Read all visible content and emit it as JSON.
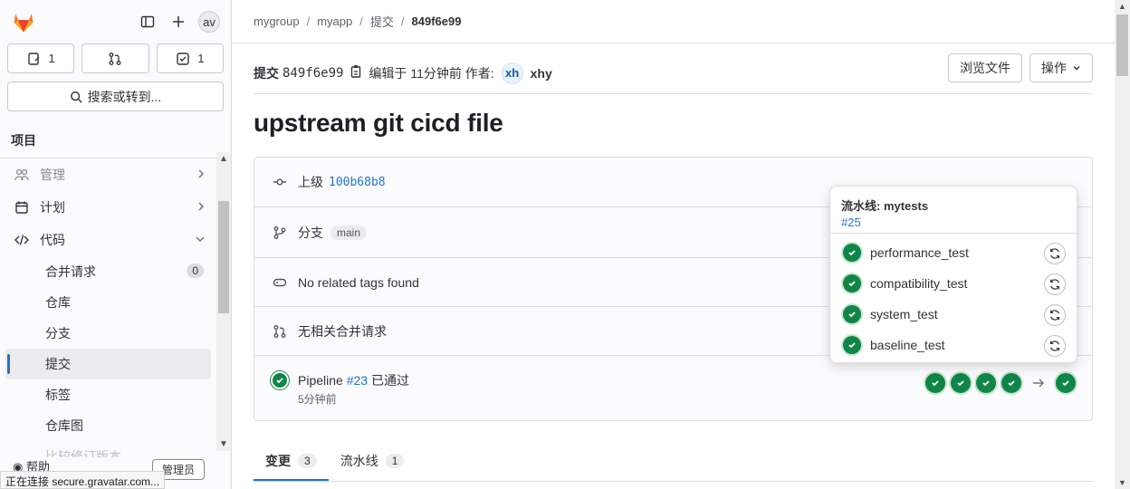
{
  "sidebar": {
    "avatar_initials": "av",
    "counters": [
      {
        "icon": "issues-icon",
        "count": "1"
      },
      {
        "icon": "merge-request-icon",
        "count": ""
      },
      {
        "icon": "todo-icon",
        "count": "1"
      }
    ],
    "search_label": "搜索或转到...",
    "section_title": "项目",
    "items": [
      {
        "label": "管理",
        "icon": "users-icon"
      },
      {
        "label": "计划",
        "icon": "calendar-icon"
      },
      {
        "label": "代码",
        "icon": "code-icon"
      }
    ],
    "subitems": [
      {
        "label": "合并请求",
        "badge": "0"
      },
      {
        "label": "仓库"
      },
      {
        "label": "分支"
      },
      {
        "label": "提交",
        "active": true
      },
      {
        "label": "标签"
      },
      {
        "label": "仓库图"
      },
      {
        "label": "比较修订版本"
      }
    ],
    "help_label": "帮助",
    "admin_label": "管理员"
  },
  "breadcrumb": [
    "mygroup",
    "myapp",
    "提交",
    "849f6e99"
  ],
  "commit": {
    "label": "提交",
    "sha": "849f6e99",
    "authored_text": "编辑于 11分钟前 作者:",
    "author_initials": "xh",
    "author_name": "xhy",
    "browse_files_label": "浏览文件",
    "actions_label": "操作",
    "title": "upstream git cicd file"
  },
  "info": {
    "parent_label": "上级",
    "parent_sha": "100b68b8",
    "branch_label": "分支",
    "branch_name": "main",
    "tags_text": "No related tags found",
    "mr_text": "无相关合并请求",
    "pipeline_label": "Pipeline",
    "pipeline_id": "#23",
    "pipeline_status": "已通过",
    "pipeline_time": "5分钟前"
  },
  "popover": {
    "title": "流水线: mytests",
    "pipeline_id": "#25",
    "jobs": [
      "performance_test",
      "compatibility_test",
      "system_test",
      "baseline_test"
    ]
  },
  "tabs": [
    {
      "label": "变更",
      "count": "3"
    },
    {
      "label": "流水线",
      "count": "1"
    }
  ],
  "status_bar": "正在连接 secure.gravatar.com...",
  "colors": {
    "success": "#108548",
    "link": "#1f75cb",
    "brand": "#fc6d26"
  }
}
